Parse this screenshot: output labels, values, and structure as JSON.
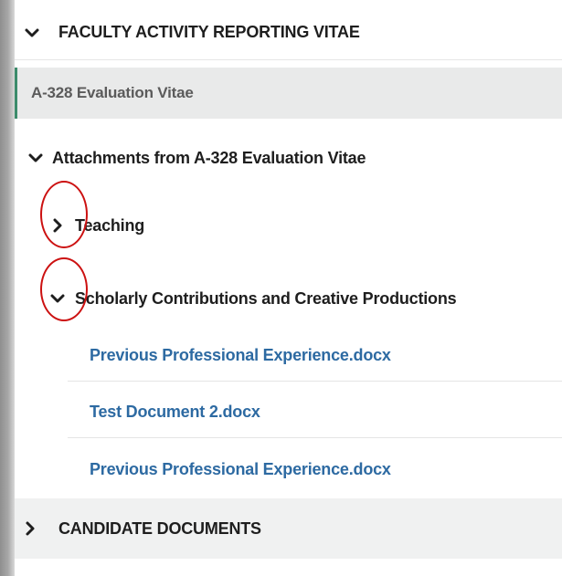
{
  "sections": {
    "faculty": {
      "label": "FACULTY ACTIVITY REPORTING VITAE",
      "icon": "chevron-down-icon",
      "expanded": true
    },
    "candidate": {
      "label": "CANDIDATE DOCUMENTS",
      "icon": "chevron-right-icon",
      "expanded": false
    }
  },
  "vitae": {
    "title": "A-328 Evaluation Vitae",
    "accent": "#3c8b6b"
  },
  "attachments": {
    "label": "Attachments from A-328 Evaluation Vitae",
    "icon": "chevron-down-icon",
    "groups": [
      {
        "label": "Teaching",
        "icon": "chevron-right-icon",
        "expanded": false
      },
      {
        "label": "Scholarly Contributions and Creative Productions",
        "icon": "chevron-down-icon",
        "expanded": true,
        "files": [
          "Previous Professional Experience.docx",
          "Test Document 2.docx",
          "Previous Professional Experience.docx"
        ]
      }
    ]
  },
  "colors": {
    "link": "#2d6aa2",
    "annotation": "#cc1111",
    "highlight_bg": "#e9eaea"
  }
}
